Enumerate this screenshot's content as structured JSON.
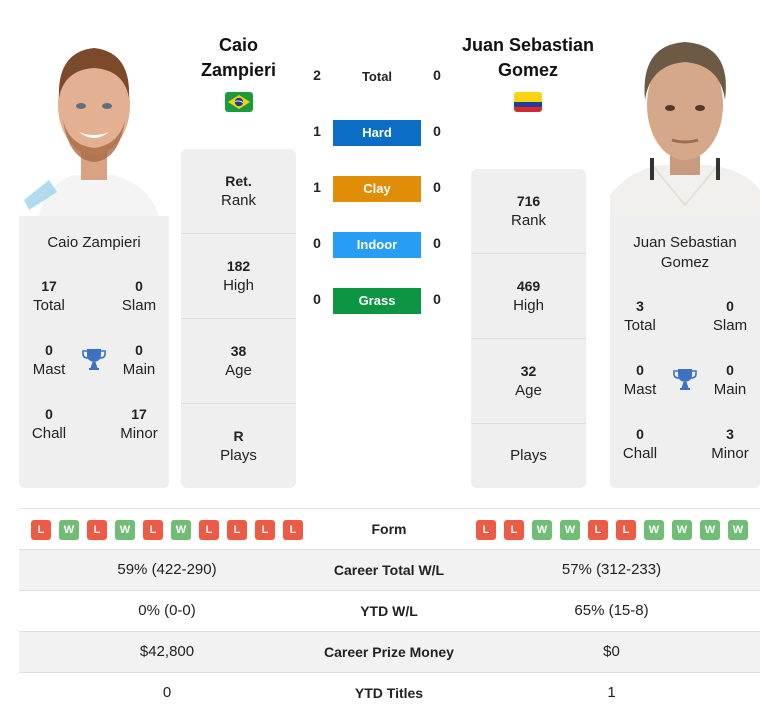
{
  "colors": {
    "hard": "#0a6ec7",
    "clay": "#e08d07",
    "indoor": "#279df5",
    "grass": "#0c9542",
    "loss": "#ee5b45",
    "win": "#71bd75",
    "trophy": "#3b73c2",
    "card_bg": "#efefef"
  },
  "players": {
    "left": {
      "name": "Caio Zampieri",
      "name_line1": "Caio",
      "name_line2": "Zampieri",
      "flag": "brazil-flag",
      "card_name": "Caio Zampieri",
      "titles": {
        "total": "17",
        "total_label": "Total",
        "slam": "0",
        "slam_label": "Slam",
        "mast": "0",
        "mast_label": "Mast",
        "main": "0",
        "main_label": "Main",
        "chall": "0",
        "chall_label": "Chall",
        "minor": "17",
        "minor_label": "Minor"
      },
      "rank": {
        "value": "Ret.",
        "label": "Rank"
      },
      "high": {
        "value": "182",
        "label": "High"
      },
      "age": {
        "value": "38",
        "label": "Age"
      },
      "plays": {
        "value": "R",
        "label": "Plays"
      }
    },
    "right": {
      "name": "Juan Sebastian Gomez",
      "name_line1": "Juan Sebastian",
      "name_line2": "Gomez",
      "flag": "colombia-flag",
      "card_name_line1": "Juan Sebastian",
      "card_name_line2": "Gomez",
      "titles": {
        "total": "3",
        "total_label": "Total",
        "slam": "0",
        "slam_label": "Slam",
        "mast": "0",
        "mast_label": "Mast",
        "main": "0",
        "main_label": "Main",
        "chall": "0",
        "chall_label": "Chall",
        "minor": "3",
        "minor_label": "Minor"
      },
      "rank": {
        "value": "716",
        "label": "Rank"
      },
      "high": {
        "value": "469",
        "label": "High"
      },
      "age": {
        "value": "32",
        "label": "Age"
      },
      "plays": {
        "value": "",
        "label": "Plays"
      }
    }
  },
  "h2h": [
    {
      "label": "Total",
      "left": "2",
      "right": "0"
    },
    {
      "label": "Hard",
      "left": "1",
      "right": "0"
    },
    {
      "label": "Clay",
      "left": "1",
      "right": "0"
    },
    {
      "label": "Indoor",
      "left": "0",
      "right": "0"
    },
    {
      "label": "Grass",
      "left": "0",
      "right": "0"
    }
  ],
  "comparison": {
    "form_label": "Form",
    "left_form": [
      "L",
      "W",
      "L",
      "W",
      "L",
      "W",
      "L",
      "L",
      "L",
      "L"
    ],
    "right_form": [
      "L",
      "L",
      "W",
      "W",
      "L",
      "L",
      "W",
      "W",
      "W",
      "W"
    ],
    "rows": [
      {
        "label": "Career Total W/L",
        "left": "59% (422-290)",
        "right": "57% (312-233)"
      },
      {
        "label": "YTD W/L",
        "left": "0% (0-0)",
        "right": "65% (15-8)"
      },
      {
        "label": "Career Prize Money",
        "left": "$42,800",
        "right": "$0"
      },
      {
        "label": "YTD Titles",
        "left": "0",
        "right": "1"
      }
    ]
  }
}
